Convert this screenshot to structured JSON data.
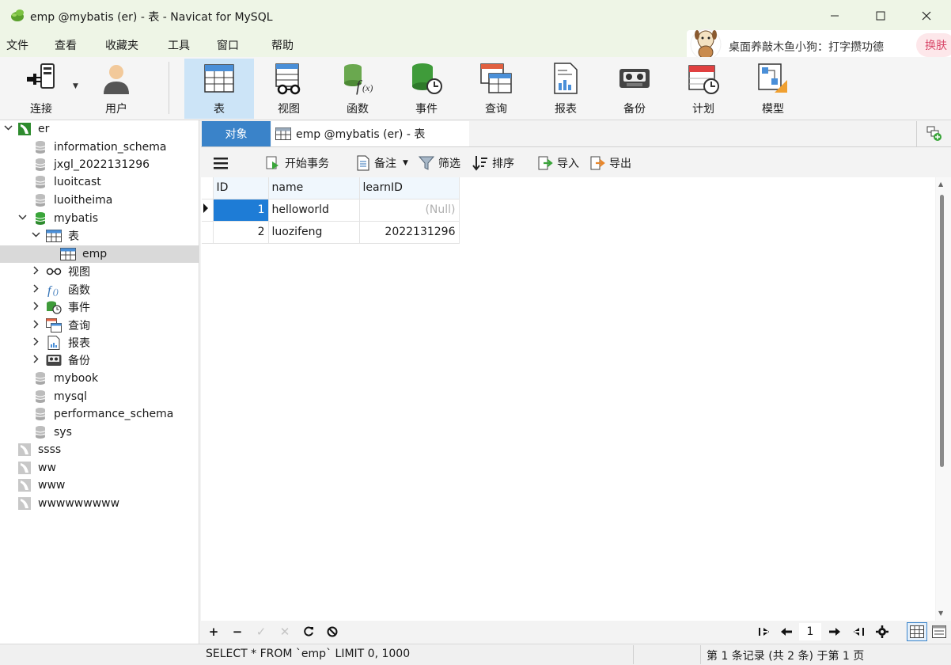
{
  "window": {
    "title": "emp @mybatis (er) - 表 - Navicat for MySQL",
    "minimize_icon": "minimize-icon",
    "maximize_icon": "maximize-icon",
    "close_icon": "close-icon"
  },
  "menu": {
    "items": [
      "文件",
      "查看",
      "收藏夹",
      "工具",
      "窗口",
      "帮助"
    ]
  },
  "popup": {
    "text": "桌面养敲木鱼小狗：打字攒功德",
    "button": "换肤"
  },
  "toolbar": {
    "items": [
      {
        "label": "连接",
        "icon": "connection-icon"
      },
      {
        "label": "用户",
        "icon": "user-icon"
      },
      {
        "label": "表",
        "icon": "table-icon",
        "active": true
      },
      {
        "label": "视图",
        "icon": "view-glasses-icon"
      },
      {
        "label": "函数",
        "icon": "function-icon"
      },
      {
        "label": "事件",
        "icon": "event-clock-icon"
      },
      {
        "label": "查询",
        "icon": "query-icon"
      },
      {
        "label": "报表",
        "icon": "report-icon"
      },
      {
        "label": "备份",
        "icon": "backup-tape-icon"
      },
      {
        "label": "计划",
        "icon": "schedule-calendar-icon"
      },
      {
        "label": "模型",
        "icon": "model-icon"
      }
    ]
  },
  "sidebar": {
    "tree": [
      {
        "label": "er",
        "icon": "connection-icon",
        "level": 0,
        "expanded": true
      },
      {
        "label": "information_schema",
        "icon": "database-icon",
        "level": 1
      },
      {
        "label": "jxgl_2022131296",
        "icon": "database-icon",
        "level": 1
      },
      {
        "label": "luoitcast",
        "icon": "database-icon",
        "level": 1
      },
      {
        "label": "luoitheima",
        "icon": "database-icon",
        "level": 1
      },
      {
        "label": "mybatis",
        "icon": "database-open-icon",
        "level": 1,
        "expanded": true
      },
      {
        "label": "表",
        "icon": "table-icon",
        "level": 2,
        "expanded": true
      },
      {
        "label": "emp",
        "icon": "table-icon",
        "level": 3,
        "selected": true
      },
      {
        "label": "视图",
        "icon": "view-glasses-icon",
        "level": 2,
        "collapsed": true
      },
      {
        "label": "函数",
        "icon": "function-icon",
        "level": 2,
        "collapsed": true
      },
      {
        "label": "事件",
        "icon": "event-clock-icon",
        "level": 2,
        "collapsed": true
      },
      {
        "label": "查询",
        "icon": "query-icon",
        "level": 2,
        "collapsed": true
      },
      {
        "label": "报表",
        "icon": "report-icon",
        "level": 2,
        "collapsed": true
      },
      {
        "label": "备份",
        "icon": "backup-tape-icon",
        "level": 2,
        "collapsed": true
      },
      {
        "label": "mybook",
        "icon": "database-icon",
        "level": 1
      },
      {
        "label": "mysql",
        "icon": "database-icon",
        "level": 1
      },
      {
        "label": "performance_schema",
        "icon": "database-icon",
        "level": 1
      },
      {
        "label": "sys",
        "icon": "database-icon",
        "level": 1
      },
      {
        "label": "ssss",
        "icon": "connection-gray-icon",
        "level": 0
      },
      {
        "label": "ww",
        "icon": "connection-gray-icon",
        "level": 0
      },
      {
        "label": "www",
        "icon": "connection-gray-icon",
        "level": 0
      },
      {
        "label": "wwwwwwwww",
        "icon": "connection-gray-icon",
        "level": 0
      }
    ]
  },
  "tabs": {
    "objects": "对象",
    "active": "emp @mybatis (er) - 表"
  },
  "subtoolbar": {
    "menu_icon": "hamburger-icon",
    "begin_transaction": "开始事务",
    "memo": "备注",
    "filter": "筛选",
    "sort": "排序",
    "import": "导入",
    "export": "导出"
  },
  "grid": {
    "columns": [
      "ID",
      "name",
      "learnID"
    ],
    "rows": [
      {
        "id": "1",
        "name": "helloworld",
        "learnID": "(Null)",
        "current": true
      },
      {
        "id": "2",
        "name": "luozifeng",
        "learnID": "2022131296"
      }
    ]
  },
  "gridbar": {
    "add": "+",
    "delete": "−",
    "apply": "✓",
    "discard": "✕",
    "refresh_icon": "refresh-icon",
    "stop_icon": "stop-icon",
    "page": "1",
    "settings_icon": "gear-icon"
  },
  "status": {
    "sql": "SELECT * FROM `emp` LIMIT 0, 1000",
    "records": "第 1 条记录 (共 2 条) 于第 1 页"
  }
}
